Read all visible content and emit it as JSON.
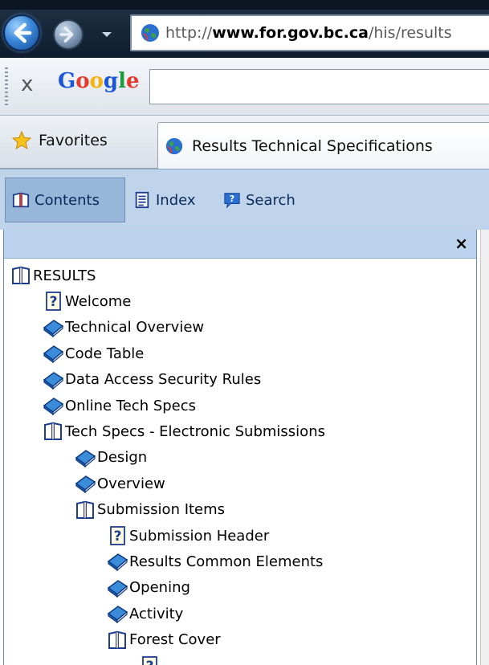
{
  "browser": {
    "url_prefix": "http://",
    "url_domain": "www.for.gov.bc.ca",
    "url_path": "/his/results"
  },
  "google_toolbar": {
    "close_label": "x",
    "logo_text": "Google",
    "search_value": ""
  },
  "favorites_label": "Favorites",
  "tab_title": "Results Technical Specifications",
  "help_tabs": {
    "contents": "Contents",
    "index": "Index",
    "search": "Search"
  },
  "pane_close": "×",
  "tree": [
    {
      "label": "RESULTS",
      "icon": "open-book-icon",
      "level": 0
    },
    {
      "label": "Welcome",
      "icon": "help-page-icon",
      "level": 1
    },
    {
      "label": "Technical Overview",
      "icon": "closed-book-icon",
      "level": 1
    },
    {
      "label": "Code Table",
      "icon": "closed-book-icon",
      "level": 1
    },
    {
      "label": "Data Access Security Rules",
      "icon": "closed-book-icon",
      "level": 1
    },
    {
      "label": "Online Tech Specs",
      "icon": "closed-book-icon",
      "level": 1
    },
    {
      "label": "Tech Specs - Electronic Submissions",
      "icon": "open-book-icon",
      "level": 1
    },
    {
      "label": "Design",
      "icon": "closed-book-icon",
      "level": 2
    },
    {
      "label": "Overview",
      "icon": "closed-book-icon",
      "level": 2
    },
    {
      "label": "Submission Items",
      "icon": "open-book-icon",
      "level": 2
    },
    {
      "label": "Submission Header",
      "icon": "help-page-icon",
      "level": 3
    },
    {
      "label": "Results Common Elements",
      "icon": "closed-book-icon",
      "level": 3
    },
    {
      "label": "Opening",
      "icon": "closed-book-icon",
      "level": 3
    },
    {
      "label": "Activity",
      "icon": "closed-book-icon",
      "level": 3
    },
    {
      "label": "Forest Cover",
      "icon": "open-book-icon",
      "level": 3
    },
    {
      "label": "",
      "icon": "help-page-icon",
      "level": 4
    }
  ]
}
